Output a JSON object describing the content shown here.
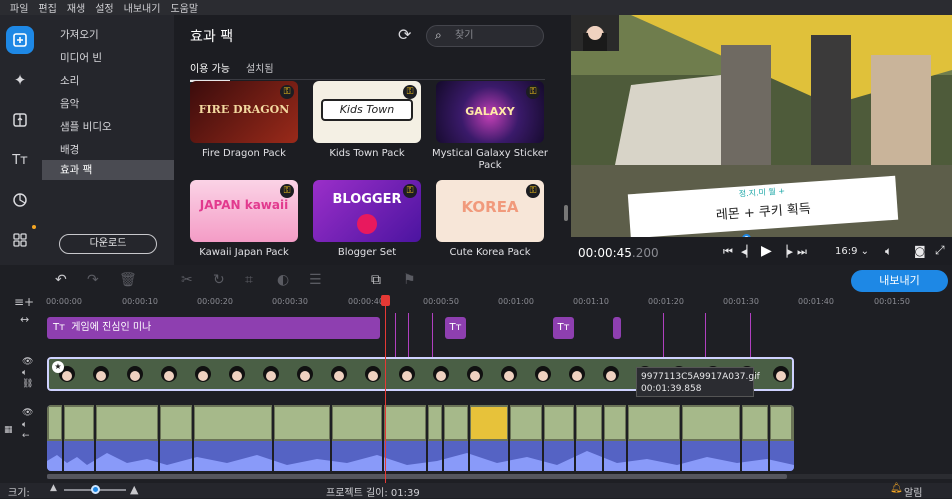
{
  "menu": [
    "파일",
    "편집",
    "재생",
    "설정",
    "내보내기",
    "도움말"
  ],
  "categories": [
    "가져오기",
    "미디어 빈",
    "소리",
    "음악",
    "샘플 비디오",
    "배경",
    "효과 팩"
  ],
  "download_label": "다운로드",
  "fx": {
    "title": "효과 팩",
    "search_placeholder": "찾기",
    "tabs": [
      "이용 가능",
      "설치됨"
    ],
    "packs": [
      {
        "label": "Fire Dragon Pack",
        "art": "FIRE DRAGON",
        "color": "#7a1e1e"
      },
      {
        "label": "Kids Town Pack",
        "art": "Kids Town",
        "color": "#f4f0e4"
      },
      {
        "label": "Mystical Galaxy Sticker Pack",
        "art": "GALAXY",
        "color": "#2b1850"
      },
      {
        "label": "Kawaii Japan Pack",
        "art": "JAPAN kawaii",
        "color": "#f6b7d2"
      },
      {
        "label": "Blogger Set",
        "art": "BLOGGER",
        "color": "#6d2bb8"
      },
      {
        "label": "Cute Korea Pack",
        "art": "KOREA",
        "color": "#f7e6d8"
      }
    ]
  },
  "preview": {
    "caption_small": "정.지.미 월 +",
    "caption_main": "레몬 + 쿠키 획득",
    "timecode": "00:00:45",
    "timecode_ms": ".200",
    "ratio": "16:9",
    "progress": 0.46
  },
  "timeline": {
    "export_label": "내보내기",
    "ruler": [
      "00:00:00",
      "00:00:10",
      "00:00:20",
      "00:00:30",
      "00:00:40",
      "00:00:50",
      "00:01:00",
      "00:01:10",
      "00:01:20",
      "00:01:30",
      "00:01:40",
      "00:01:50"
    ],
    "title_clip": "게임에 진심인 미나",
    "tooltip_name": "9977113C5A9917A037.gif",
    "tooltip_time": "00:01:39.858"
  },
  "status": {
    "size_label": "크기:",
    "length_label": "프로젝트 길이: 01:39",
    "notifications": "알림"
  },
  "colors": {
    "accent": "#1e88e5",
    "title_clip": "#8e3fb0",
    "playhead": "#e53935",
    "audio": "#5968c8"
  }
}
